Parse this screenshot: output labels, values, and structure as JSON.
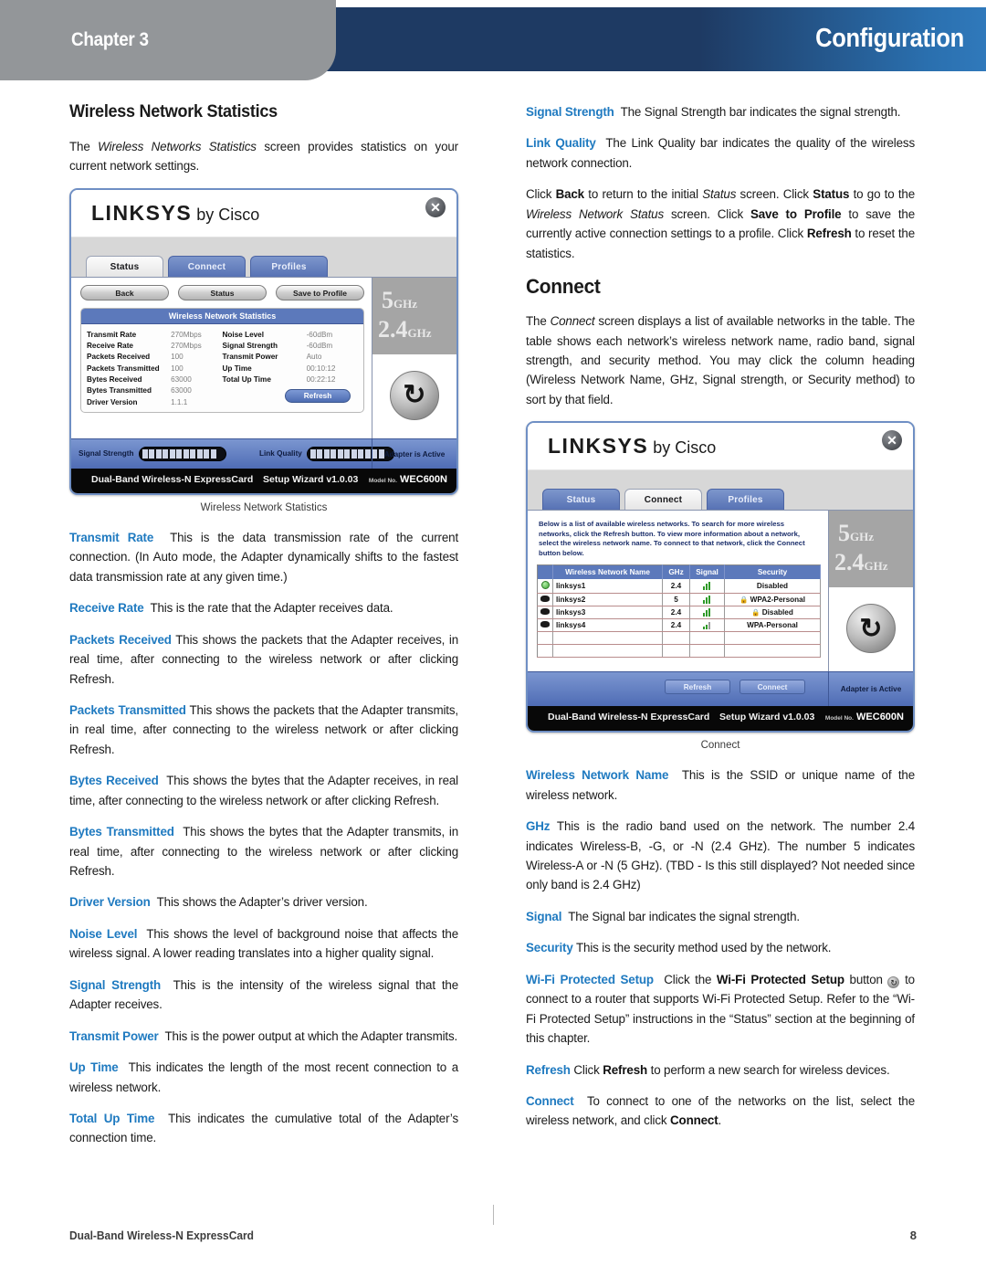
{
  "header": {
    "chapter_label": "Chapter 3",
    "title": "Configuration"
  },
  "left_column": {
    "section_title": "Wireless Network Statistics",
    "intro_pre": "The ",
    "intro_italic": "Wireless Networks Statistics",
    "intro_post": " screen provides statistics on your current network settings.",
    "figure_caption": "Wireless Network Statistics",
    "terms": [
      {
        "term": "Transmit Rate",
        "desc": "This is the data transmission rate of the current connection. (In Auto mode, the Adapter dynamically shifts to the fastest data transmission rate at any given time.)"
      },
      {
        "term": "Receive Rate",
        "desc": "This is the rate that the Adapter receives data."
      },
      {
        "term": "Packets Received",
        "desc": "This shows the packets that the Adapter receives, in real time, after connecting to the wireless network or after clicking Refresh."
      },
      {
        "term": "Packets Transmitted",
        "desc": "This shows the packets that the Adapter transmits, in real time, after connecting to the wireless network or after clicking Refresh."
      },
      {
        "term": "Bytes Received",
        "desc": "This shows the bytes that the Adapter receives, in real time, after connecting to the wireless network or after clicking Refresh."
      },
      {
        "term": "Bytes Transmitted",
        "desc": "This shows the bytes that the Adapter transmits, in real time, after connecting to the wireless network or after clicking Refresh."
      },
      {
        "term": "Driver Version",
        "desc": "This shows the Adapter’s driver version."
      },
      {
        "term": "Noise Level",
        "desc": "This shows the level of background noise that affects the wireless signal. A lower reading translates into a higher quality signal."
      },
      {
        "term": "Signal Strength",
        "desc": "This is the intensity of the wireless signal that the Adapter receives."
      },
      {
        "term": "Transmit Power",
        "desc": "This is the power output at which the Adapter transmits."
      },
      {
        "term": "Up Time",
        "desc": "This indicates the length of the most recent connection to a wireless network."
      },
      {
        "term": "Total Up Time",
        "desc": "This indicates the cumulative total of the Adapter’s connection time."
      }
    ]
  },
  "right_column": {
    "top_terms": [
      {
        "term": "Signal Strength",
        "desc": "The Signal Strength bar indicates the signal strength."
      },
      {
        "term": "Link Quality",
        "desc": "The Link Quality bar indicates the quality of the wireless network connection."
      }
    ],
    "click_paragraph": {
      "p1": "Click ",
      "b1": "Back",
      "p2": " to return to the initial ",
      "i1": "Status",
      "p3": " screen. Click ",
      "b2": "Status",
      "p4": " to go to the ",
      "i2": "Wireless Network Status",
      "p5": " screen. Click ",
      "b3": "Save to Profile",
      "p6": " to save the currently active connection settings to a profile. Click ",
      "b4": "Refresh",
      "p7": " to reset the statistics."
    },
    "connect_title": "Connect",
    "connect_intro_pre": "The ",
    "connect_intro_italic": "Connect",
    "connect_intro_post": " screen displays a list of available networks in the table. The table shows each network’s wireless network name, radio band, signal strength, and security method. You may click the column heading (Wireless Network Name, GHz, Signal strength, or Security method) to sort by that field.",
    "figure_caption": "Connect",
    "bottom_terms": [
      {
        "term": "Wireless Network Name",
        "desc": "This is the SSID or unique name of the wireless network."
      },
      {
        "term": "GHz",
        "desc": "This is the radio band used on the network. The number 2.4 indicates Wireless-B, -G, or -N (2.4 GHz). The number 5 indicates Wireless-A or -N (5 GHz). (TBD - Is this still displayed? Not needed since only band is 2.4 GHz)"
      },
      {
        "term": "Signal",
        "desc": "The Signal bar indicates the signal strength."
      },
      {
        "term": "Security",
        "desc": "This is the security method used by the network."
      }
    ],
    "wps_paragraph": {
      "term": "Wi-Fi Protected Setup",
      "p1": "Click the ",
      "b1": "Wi-Fi Protected Setup",
      "p2": " button ",
      "icon": "↻",
      "p3": " to connect to a router that supports Wi-Fi Protected Setup. Refer to the “Wi-Fi Protected Setup” instructions in the “Status” section at the beginning of this chapter."
    },
    "refresh_paragraph": {
      "term": "Refresh",
      "p1": "Click ",
      "b1": "Refresh",
      "p2": " to perform a new search for wireless devices."
    },
    "connect_paragraph": {
      "term": "Connect",
      "p1": "To connect to one of the networks on the list, select the wireless network, and click ",
      "b1": "Connect",
      "p2": "."
    }
  },
  "screenshot_status": {
    "brand": "LINKSYS",
    "brand_suffix": " by Cisco",
    "close_glyph": "✕",
    "tabs": [
      {
        "label": "Status",
        "active": true
      },
      {
        "label": "Connect",
        "active": false
      },
      {
        "label": "Profiles",
        "active": false
      }
    ],
    "buttons": [
      "Back",
      "Status",
      "Save to Profile"
    ],
    "stats_header": "Wireless Network Statistics",
    "stats_left": [
      {
        "label": "Transmit Rate",
        "value": "270Mbps"
      },
      {
        "label": "Receive Rate",
        "value": "270Mbps"
      },
      {
        "label": "Packets Received",
        "value": "100"
      },
      {
        "label": "Packets Transmitted",
        "value": "100"
      },
      {
        "label": "Bytes Received",
        "value": "63000"
      },
      {
        "label": "Bytes Transmitted",
        "value": "63000"
      },
      {
        "label": "Driver Version",
        "value": "1.1.1"
      }
    ],
    "stats_right": [
      {
        "label": "Noise Level",
        "value": "-60dBm"
      },
      {
        "label": "Signal Strength",
        "value": "-60dBm"
      },
      {
        "label": "Transmit Power",
        "value": "Auto"
      },
      {
        "label": "Up Time",
        "value": "00:10:12"
      },
      {
        "label": "Total Up Time",
        "value": "00:22:12"
      }
    ],
    "refresh_label": "Refresh",
    "band_5": "5",
    "band_5_unit": "GHz",
    "band_24": "2.4",
    "band_24_unit": "GHz",
    "wps_glyph": "↻",
    "signal_strength_label": "Signal Strength",
    "link_quality_label": "Link Quality",
    "adapter_status": "Adapter is Active",
    "footer_left": "Dual-Band Wireless-N ExpressCard",
    "footer_mid": "Setup Wizard v1.0.03",
    "footer_model_prefix": "Model No.",
    "footer_model": "WEC600N"
  },
  "screenshot_connect": {
    "brand": "LINKSYS",
    "brand_suffix": " by Cisco",
    "close_glyph": "✕",
    "tabs": [
      {
        "label": "Status",
        "active": false
      },
      {
        "label": "Connect",
        "active": true
      },
      {
        "label": "Profiles",
        "active": false
      }
    ],
    "description": "Below is a list of available wireless networks. To search for more wireless networks, click the Refresh button. To view more information about a network, select the wireless network name. To connect to that network, click the Connect button below.",
    "table_headers": [
      "",
      "Wireless Network Name",
      "GHz",
      "Signal",
      "Security"
    ],
    "networks": [
      {
        "status": "selected",
        "name": "linksys1",
        "ghz": "2.4",
        "signal": 3,
        "locked": false,
        "security": "Disabled"
      },
      {
        "status": "normal",
        "name": "linksys2",
        "ghz": "5",
        "signal": 3,
        "locked": true,
        "security": "WPA2-Personal"
      },
      {
        "status": "normal",
        "name": "linksys3",
        "ghz": "2.4",
        "signal": 3,
        "locked": true,
        "security": "Disabled"
      },
      {
        "status": "normal",
        "name": "linksys4",
        "ghz": "2.4",
        "signal": 2,
        "locked": false,
        "security": "WPA-Personal"
      }
    ],
    "buttons": [
      "Refresh",
      "Connect"
    ],
    "band_5": "5",
    "band_5_unit": "GHz",
    "band_24": "2.4",
    "band_24_unit": "GHz",
    "wps_glyph": "↻",
    "adapter_status": "Adapter is Active",
    "footer_left": "Dual-Band Wireless-N ExpressCard",
    "footer_mid": "Setup Wizard v1.0.03",
    "footer_model_prefix": "Model No.",
    "footer_model": "WEC600N"
  },
  "page_footer": {
    "doc_title": "Dual-Band Wireless-N ExpressCard",
    "page_number": "8"
  }
}
